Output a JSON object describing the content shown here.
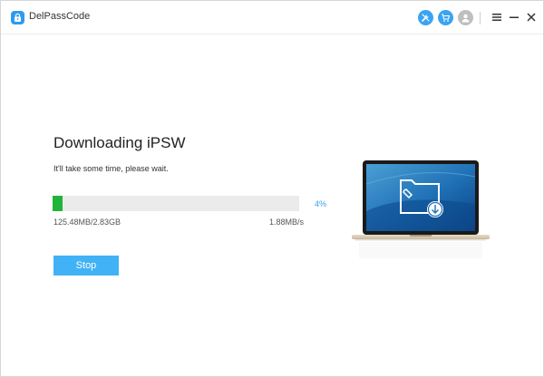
{
  "app": {
    "title": "DelPassCode"
  },
  "header_icons": [
    "tools-icon",
    "cart-icon",
    "user-icon",
    "menu-icon",
    "minimize-icon",
    "close-icon"
  ],
  "main": {
    "heading": "Downloading iPSW",
    "subtitle": "It'll take some time, please wait.",
    "progress": {
      "percent_label": "4%",
      "value": 0.04,
      "downloaded": "125.48MB/2.83GB",
      "speed": "1.88MB/s"
    },
    "stop_label": "Stop"
  },
  "colors": {
    "accent": "#3aa4f2",
    "progress_fill": "#20b53a",
    "percent_text": "#3a9ee8"
  }
}
